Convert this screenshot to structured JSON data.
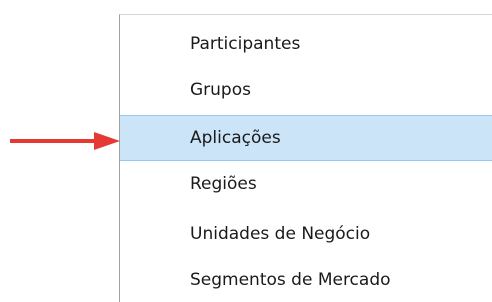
{
  "menu": {
    "items": [
      {
        "label": "Participantes",
        "highlighted": false
      },
      {
        "label": "Grupos",
        "highlighted": false
      },
      {
        "label": "Aplicações",
        "highlighted": true
      },
      {
        "label": "Regiões",
        "highlighted": false
      },
      {
        "label": "Unidades de Negócio",
        "highlighted": false
      },
      {
        "label": "Segmentos de Mercado",
        "highlighted": false
      }
    ]
  },
  "colors": {
    "highlight_background": "#cce4f7",
    "highlight_border": "#99c9ef",
    "arrow": "#e53935"
  },
  "annotation": {
    "icon": "red-arrow-right-icon"
  }
}
